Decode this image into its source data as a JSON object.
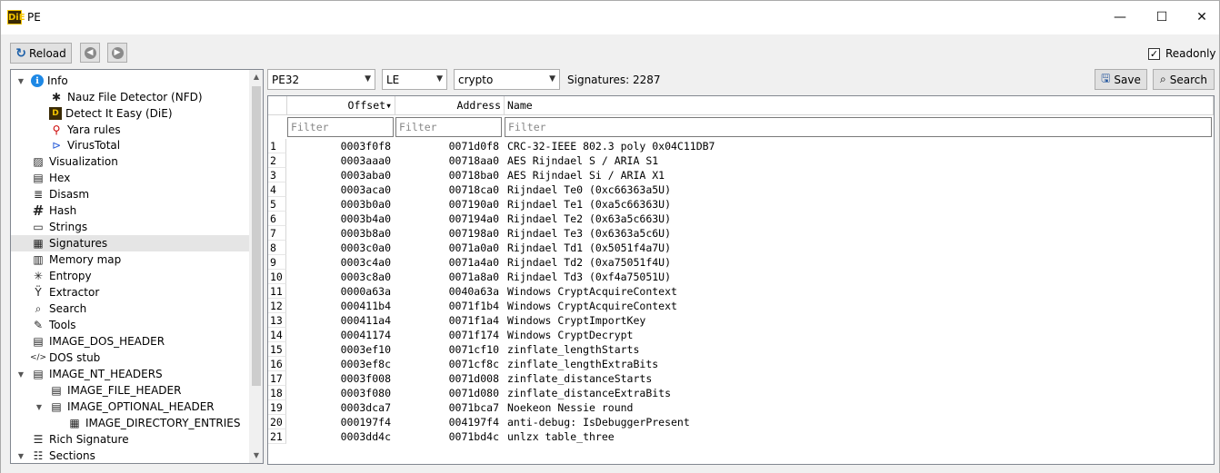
{
  "window": {
    "title": "PE",
    "app_icon": "DiE",
    "minimize": "—",
    "maximize": "☐",
    "close": "✕"
  },
  "toolbar": {
    "reload_label": "Reload",
    "readonly_label": "Readonly",
    "readonly_checked": "✓"
  },
  "tree": {
    "items": [
      {
        "label": "Info",
        "icon": "info-icon",
        "expander": "▼"
      },
      {
        "label": "Nauz File Detector (NFD)",
        "icon": "nfd-icon"
      },
      {
        "label": "Detect It Easy (DiE)",
        "icon": "die-icon"
      },
      {
        "label": "Yara rules",
        "icon": "yara-icon"
      },
      {
        "label": "VirusTotal",
        "icon": "virustotal-icon"
      },
      {
        "label": "Visualization",
        "icon": "visualization-icon"
      },
      {
        "label": "Hex",
        "icon": "hex-icon"
      },
      {
        "label": "Disasm",
        "icon": "disasm-icon"
      },
      {
        "label": "Hash",
        "icon": "hash-icon"
      },
      {
        "label": "Strings",
        "icon": "strings-icon"
      },
      {
        "label": "Signatures",
        "icon": "signatures-icon"
      },
      {
        "label": "Memory map",
        "icon": "memory-map-icon"
      },
      {
        "label": "Entropy",
        "icon": "entropy-icon"
      },
      {
        "label": "Extractor",
        "icon": "extractor-icon"
      },
      {
        "label": "Search",
        "icon": "search-icon"
      },
      {
        "label": "Tools",
        "icon": "tools-icon"
      },
      {
        "label": "IMAGE_DOS_HEADER",
        "icon": "header-icon"
      },
      {
        "label": "DOS stub",
        "icon": "code-icon"
      },
      {
        "label": "IMAGE_NT_HEADERS",
        "icon": "header-icon",
        "expander": "▼"
      },
      {
        "label": "IMAGE_FILE_HEADER",
        "icon": "header-icon"
      },
      {
        "label": "IMAGE_OPTIONAL_HEADER",
        "icon": "header-icon",
        "expander": "▼"
      },
      {
        "label": "IMAGE_DIRECTORY_ENTRIES",
        "icon": "table-icon"
      },
      {
        "label": "Rich Signature",
        "icon": "list-icon"
      },
      {
        "label": "Sections",
        "icon": "sections-icon",
        "expander": "▼"
      }
    ]
  },
  "filters": {
    "mode": "PE32",
    "endian": "LE",
    "type": "crypto",
    "signatures_text": "Signatures: 2287"
  },
  "actions": {
    "save_label": "Save",
    "search_label": "Search"
  },
  "table": {
    "columns": {
      "offset": "Offset",
      "address": "Address",
      "name": "Name",
      "sort_indicator": "▾"
    },
    "filter_placeholder": "Filter",
    "rows": [
      {
        "n": "1",
        "offset": "0003f0f8",
        "address": "0071d0f8",
        "name": "CRC-32-IEEE 802.3 poly 0x04C11DB7"
      },
      {
        "n": "2",
        "offset": "0003aaa0",
        "address": "00718aa0",
        "name": "AES Rijndael S / ARIA S1"
      },
      {
        "n": "3",
        "offset": "0003aba0",
        "address": "00718ba0",
        "name": "AES Rijndael Si / ARIA X1"
      },
      {
        "n": "4",
        "offset": "0003aca0",
        "address": "00718ca0",
        "name": "Rijndael Te0 (0xc66363a5U)"
      },
      {
        "n": "5",
        "offset": "0003b0a0",
        "address": "007190a0",
        "name": "Rijndael Te1 (0xa5c66363U)"
      },
      {
        "n": "6",
        "offset": "0003b4a0",
        "address": "007194a0",
        "name": "Rijndael Te2 (0x63a5c663U)"
      },
      {
        "n": "7",
        "offset": "0003b8a0",
        "address": "007198a0",
        "name": "Rijndael Te3 (0x6363a5c6U)"
      },
      {
        "n": "8",
        "offset": "0003c0a0",
        "address": "0071a0a0",
        "name": "Rijndael Td1 (0x5051f4a7U)"
      },
      {
        "n": "9",
        "offset": "0003c4a0",
        "address": "0071a4a0",
        "name": "Rijndael Td2 (0xa75051f4U)"
      },
      {
        "n": "10",
        "offset": "0003c8a0",
        "address": "0071a8a0",
        "name": "Rijndael Td3 (0xf4a75051U)"
      },
      {
        "n": "11",
        "offset": "0000a63a",
        "address": "0040a63a",
        "name": "Windows CryptAcquireContext"
      },
      {
        "n": "12",
        "offset": "000411b4",
        "address": "0071f1b4",
        "name": "Windows CryptAcquireContext"
      },
      {
        "n": "13",
        "offset": "000411a4",
        "address": "0071f1a4",
        "name": "Windows CryptImportKey"
      },
      {
        "n": "14",
        "offset": "00041174",
        "address": "0071f174",
        "name": "Windows CryptDecrypt"
      },
      {
        "n": "15",
        "offset": "0003ef10",
        "address": "0071cf10",
        "name": "zinflate_lengthStarts"
      },
      {
        "n": "16",
        "offset": "0003ef8c",
        "address": "0071cf8c",
        "name": "zinflate_lengthExtraBits"
      },
      {
        "n": "17",
        "offset": "0003f008",
        "address": "0071d008",
        "name": "zinflate_distanceStarts"
      },
      {
        "n": "18",
        "offset": "0003f080",
        "address": "0071d080",
        "name": "zinflate_distanceExtraBits"
      },
      {
        "n": "19",
        "offset": "0003dca7",
        "address": "0071bca7",
        "name": "Noekeon Nessie round"
      },
      {
        "n": "20",
        "offset": "000197f4",
        "address": "004197f4",
        "name": "anti-debug: IsDebuggerPresent"
      },
      {
        "n": "21",
        "offset": "0003dd4c",
        "address": "0071bd4c",
        "name": "unlzx table_three"
      }
    ]
  }
}
